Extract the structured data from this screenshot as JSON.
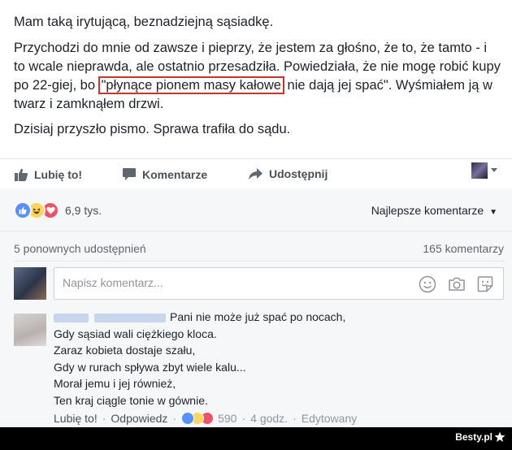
{
  "post": {
    "line1": "Mam taką irytującą, beznadziejną sąsiadkę.",
    "p2_before": "Przychodzi do mnie od zawsze i pieprzy, że jestem za głośno, że to, że tamto - i to wcale nieprawda, ale ostatnio przesadziła. Powiedziała, że nie mogę robić kupy po 22-giej, bo ",
    "p2_highlight": "\"płynące pionem masy kałowe",
    "p2_after": " nie dają jej spać\". Wyśmiałem ją w twarz i zamknąłem drzwi.",
    "line3": "Dzisiaj przyszło pismo. Sprawa trafiła do sądu."
  },
  "actions": {
    "like": "Lubię to!",
    "comment": "Komentarze",
    "share": "Udostępnij"
  },
  "reactions": {
    "count": "6,9 tys.",
    "icons": [
      "like-icon",
      "haha-icon",
      "love-icon"
    ],
    "sort": "Najlepsze komentarze"
  },
  "stats": {
    "shares": "5 ponownych udostępnień",
    "comments": "165 komentarzy"
  },
  "composer": {
    "placeholder": "Napisz komentarz..."
  },
  "comment": {
    "lines": [
      "Pani nie może już spać po nocach,",
      "Gdy sąsiad wali ciężkiego kloca.",
      "Zaraz kobieta dostaje szału,",
      "Gdy w rurach spływa zbyt wiele kalu...",
      "Morał jemu i jej również,",
      "Ten kraj ciągle tonie w gównie."
    ],
    "like": "Lubię to!",
    "reply": "Odpowiedz",
    "reaction_count": "590",
    "time": "4 godz.",
    "edited": "Edytowany"
  },
  "watermark": "Besty.pl",
  "colors": {
    "highlight_border": "#c0392b",
    "like_blue": "#5890ff",
    "love_red": "#f25268",
    "haha_yellow": "#fbd55d"
  }
}
